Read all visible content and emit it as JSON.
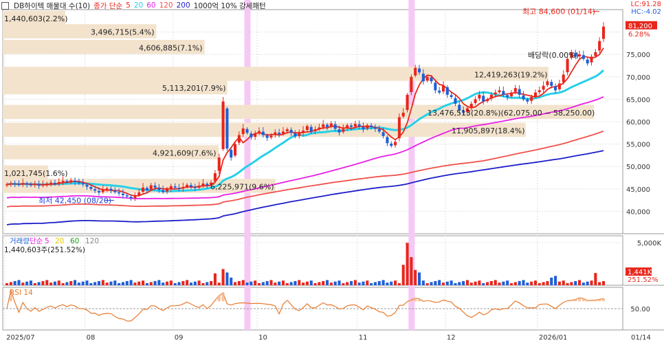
{
  "header": {
    "symbol": "DB하이텍 매물대 수(10)",
    "ma_label": "종가 단순",
    "ma_periods": [
      "5",
      "20",
      "60",
      "120",
      "200"
    ],
    "ma_colors": [
      "#e8261c",
      "#27d0e8",
      "#e81ee8",
      "#f0504b",
      "#1c1cc8"
    ],
    "pattern": "1000억 10% 강세패턴",
    "lc": "LC:91.28",
    "hc": "HC:-4.02"
  },
  "price_panel": {
    "y_ticks": [
      "75,000",
      "70,000",
      "65,000",
      "60,000",
      "55,000",
      "50,000",
      "45,000",
      "40,000"
    ],
    "last_price": "81,200",
    "last_change": "6.28%",
    "high_label": "최고 84,600 (01/14)",
    "low_label": "최저 42,450 (08/20)",
    "dividend_label": "배당락(0.00%)",
    "volume_profile": [
      {
        "label": "1,440,603(2.2%)",
        "bar": 0.022
      },
      {
        "label": "3,496,715(5.4%)",
        "bar": 0.054
      },
      {
        "label": "4,606,885(7.1%)",
        "bar": 0.071
      },
      {
        "label": "12,419,263(19.2%)",
        "bar": 0.192
      },
      {
        "label": "5,113,201(7.9%)",
        "bar": 0.079
      },
      {
        "label": "13,476,513(20.8%)(62,075.00 ~ 58,250.00)",
        "bar": 0.208
      },
      {
        "label": "11,905,897(18.4%)",
        "bar": 0.184
      },
      {
        "label": "4,921,609(7.6%)",
        "bar": 0.076
      },
      {
        "label": "1,021,745(1.6%)",
        "bar": 0.016
      },
      {
        "label": "6,225,971(9.6%)",
        "bar": 0.096
      }
    ]
  },
  "volume_panel": {
    "title": "거래량",
    "ma_label": "단순",
    "ma_periods": [
      "5",
      "20",
      "60",
      "120"
    ],
    "ma_colors": [
      "#e81ee8",
      "#e8c800",
      "#20a020",
      "#888888"
    ],
    "info": "1,440,603주(251.52%)",
    "y_tick": "5,000K",
    "last_volume": "1,441K",
    "last_pct": "251.52%"
  },
  "rsi_panel": {
    "title": "RSI 14",
    "y_tick": "50.00"
  },
  "x_axis": {
    "labels": [
      "2025/07",
      "08",
      "09",
      "10",
      "11",
      "12",
      "2026/01",
      "01/14"
    ]
  },
  "chart_data": {
    "type": "candlestick",
    "price_range": [
      35000,
      85000
    ],
    "x_range": [
      "2025/07",
      "2026/01/14"
    ],
    "high": {
      "value": 84600,
      "date": "01/14"
    },
    "low": {
      "value": 42450,
      "date": "08/20"
    },
    "last_close": 81200,
    "closes": [
      46000,
      46200,
      46100,
      45900,
      46300,
      46000,
      45800,
      46100,
      45700,
      45900,
      46200,
      46400,
      46100,
      46500,
      46800,
      46600,
      46900,
      46500,
      46300,
      46000,
      45500,
      45000,
      44600,
      44200,
      44800,
      45100,
      44700,
      44300,
      44000,
      43600,
      43300,
      42900,
      43500,
      44200,
      45300,
      44700,
      45800,
      45300,
      44800,
      44300,
      45000,
      45600,
      45300,
      45000,
      45400,
      45900,
      45500,
      45200,
      45700,
      46200,
      45800,
      46400,
      48500,
      52000,
      64500,
      54000,
      52000,
      55000,
      57000,
      58500,
      57500,
      56500,
      57300,
      57900,
      57000,
      56400,
      56900,
      57600,
      57200,
      57800,
      58300,
      57500,
      56700,
      57400,
      58000,
      59000,
      57800,
      58300,
      58700,
      59400,
      58800,
      59600,
      58400,
      57600,
      58400,
      59200,
      58800,
      59500,
      58900,
      58300,
      59200,
      58800,
      58400,
      57800,
      56800,
      55200,
      54600,
      55500,
      61000,
      62000,
      66000,
      70000,
      72000,
      71000,
      69000,
      70000,
      69000,
      67000,
      66500,
      68000,
      66000,
      65500,
      64000,
      62500,
      62000,
      63000,
      64000,
      65000,
      66000,
      64500,
      65000,
      66000,
      66500,
      67000,
      66000,
      65500,
      66500,
      67500,
      66000,
      65000,
      64500,
      65500,
      66500,
      67000,
      68000,
      69000,
      68000,
      67000,
      68500,
      70500,
      74000,
      75500,
      74500,
      75000,
      74000,
      73000,
      74500,
      75500,
      78000,
      81200
    ],
    "series": [
      {
        "name": "5",
        "role": "price moving average",
        "color": "#e8261c"
      },
      {
        "name": "20",
        "role": "price moving average",
        "color": "#27d0e8"
      },
      {
        "name": "60",
        "role": "price moving average",
        "color": "#e81ee8"
      },
      {
        "name": "120",
        "role": "price moving average",
        "color": "#f0504b"
      },
      {
        "name": "200",
        "role": "price moving average",
        "color": "#1c1cc8"
      }
    ],
    "highlight_sessions": [
      "09 (late)",
      "11 (mid)"
    ],
    "volume_last": 1440603,
    "rsi_period": 14,
    "rsi_reference": 50
  },
  "colors": {
    "up": "#e8261c",
    "down": "#1f5fd6",
    "volume_profile_fill": "#f3e3cd",
    "highlight": "#f6c8f6",
    "grid": "#e0e0e0",
    "rsi_line": "#e87a2c",
    "rsi_fill": "#f3b58a"
  }
}
